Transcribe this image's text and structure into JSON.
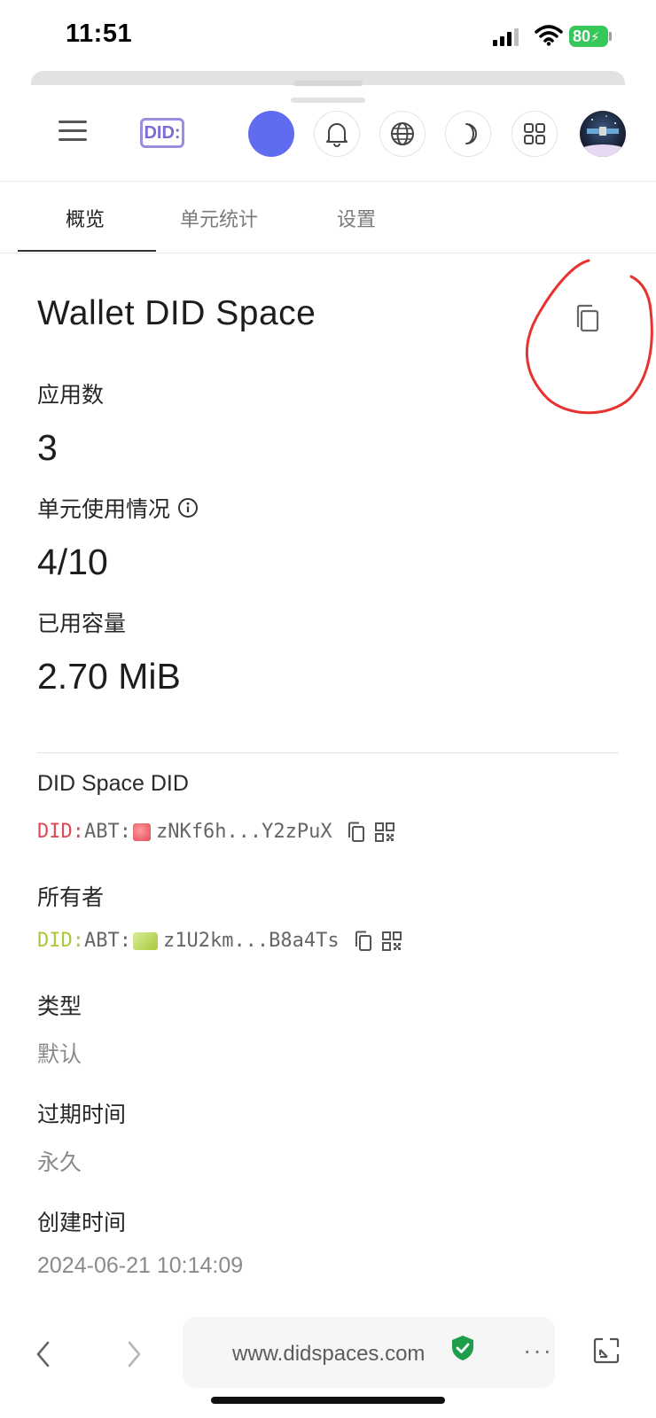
{
  "status_bar": {
    "time": "11:51",
    "battery": "80"
  },
  "header": {
    "logo_text": "DID:"
  },
  "tabs": [
    {
      "label": "概览"
    },
    {
      "label": "单元统计"
    },
    {
      "label": "设置"
    }
  ],
  "overview": {
    "title": "Wallet DID Space",
    "apps_label": "应用数",
    "apps_value": "3",
    "units_label": "单元使用情况",
    "units_value": "4/10",
    "capacity_label": "已用容量",
    "capacity_value": "2.70 MiB"
  },
  "details": {
    "space_did_label": "DID Space DID",
    "space_did_prefix": "DID:",
    "space_did_type": "ABT:",
    "space_did_value": "zNKf6h...Y2zPuX",
    "owner_label": "所有者",
    "owner_did_prefix": "DID:",
    "owner_did_type": "ABT:",
    "owner_did_value": "z1U2km...B8a4Ts",
    "type_label": "类型",
    "type_value": "默认",
    "expire_label": "过期时间",
    "expire_value": "永久",
    "created_label": "创建时间",
    "created_value": "2024-06-21 10:14:09"
  },
  "browser": {
    "url": "www.didspaces.com",
    "more": "···"
  },
  "colors": {
    "accent_blue": "#5f6cf0",
    "logo_purple": "#7c6bd6",
    "did_red": "#e04a55",
    "did_green": "#a9c93a",
    "annotation_red": "#e8322f",
    "secure_green": "#1e9e4a"
  }
}
